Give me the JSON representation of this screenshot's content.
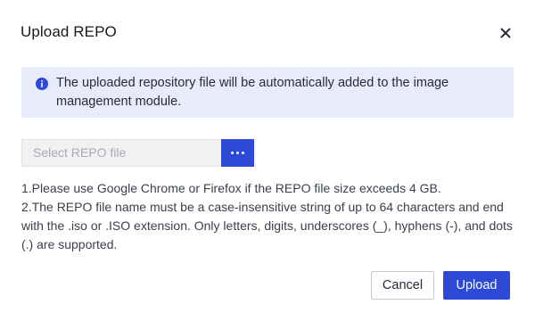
{
  "dialog": {
    "title": "Upload REPO",
    "close_icon": "close-icon"
  },
  "info": {
    "icon": "info-icon",
    "text": "The uploaded repository file will be automatically added to the image management module."
  },
  "file_select": {
    "placeholder": "Select REPO file",
    "browse_icon": "more-horizontal-icon"
  },
  "notes": [
    "1.Please use Google Chrome or Firefox if the REPO file size exceeds 4 GB.",
    "2.The REPO file name must be a case-insensitive string of up to 64 characters and end with the .iso or .ISO extension. Only letters, digits, underscores (_), hyphens (-), and dots (.) are supported."
  ],
  "footer": {
    "cancel_label": "Cancel",
    "upload_label": "Upload"
  },
  "colors": {
    "primary": "#2e49d6",
    "info_background": "#e8ecfa"
  }
}
